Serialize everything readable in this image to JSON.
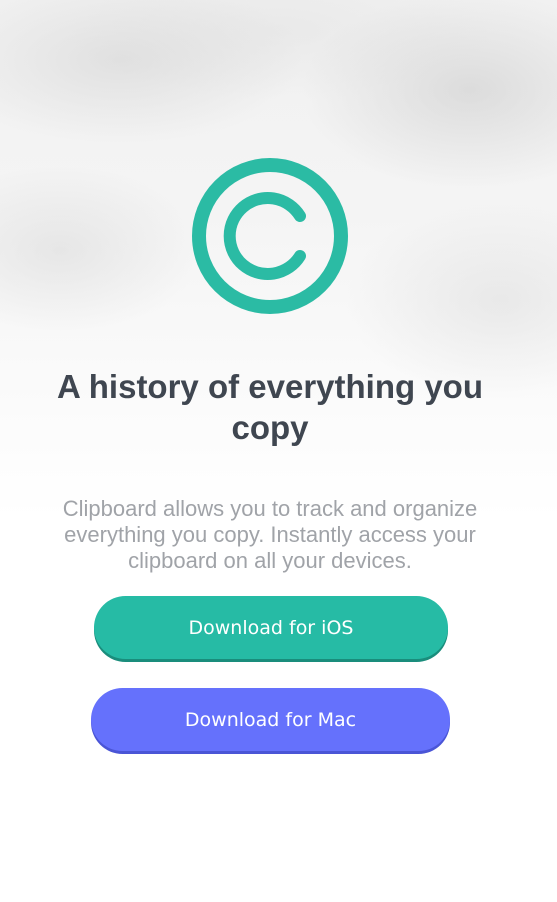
{
  "hero": {
    "logo_icon": "copyright-icon",
    "accent_color": "#2bbba4",
    "headline": "A history of everything you copy",
    "description": "Clipboard allows you to track and organize everything you copy. Instantly access your clipboard on all your devices."
  },
  "actions": {
    "ios_label": "Download for iOS",
    "ios_color": "#26bba5",
    "mac_label": "Download for Mac",
    "mac_color": "#6571fc"
  }
}
